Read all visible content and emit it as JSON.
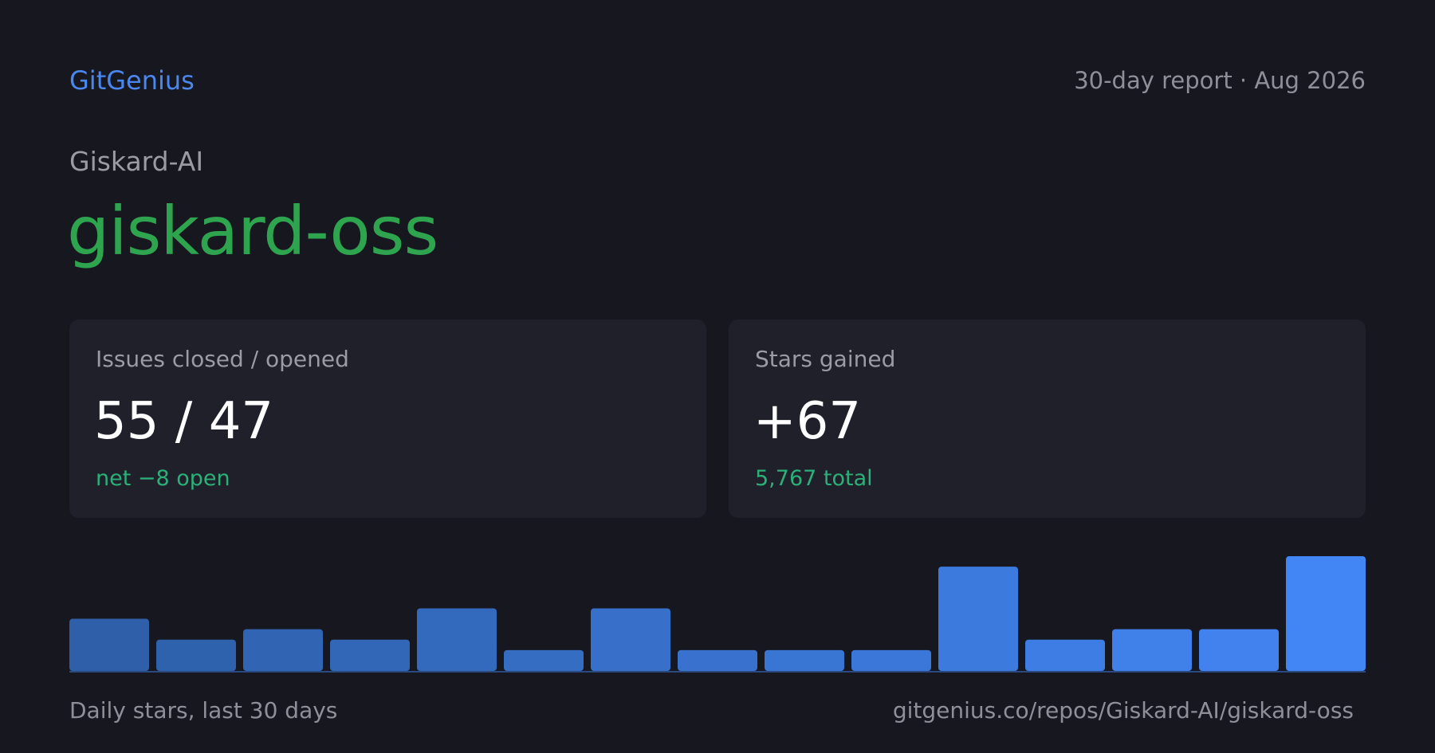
{
  "header": {
    "brand": "GitGenius",
    "report": "30-day report · Aug 2026"
  },
  "repo": {
    "org": "Giskard-AI",
    "name": "giskard-oss"
  },
  "cards": [
    {
      "label": "Issues closed / opened",
      "value": "55 / 47",
      "sub": "net −8 open"
    },
    {
      "label": "Stars gained",
      "value": "+67",
      "sub": "5,767 total"
    }
  ],
  "footer": {
    "caption": "Daily stars, last 30 days",
    "url": "gitgenius.co/repos/Giskard-AI/giskard-oss"
  },
  "colors": {
    "brand": "#4a88f0",
    "repo": "#2ea44f",
    "positive": "#2bb07a",
    "bar_gradient_start": "#2e5fa8",
    "bar_gradient_end": "#4285f4"
  },
  "chart_data": {
    "type": "bar",
    "categories": [
      "",
      "",
      "",
      "",
      "",
      "",
      "",
      "",
      "",
      "",
      "",
      "",
      "",
      "",
      ""
    ],
    "values": [
      5,
      3,
      4,
      3,
      6,
      2,
      6,
      2,
      2,
      2,
      10,
      3,
      4,
      4,
      11
    ],
    "title": "",
    "xlabel": "",
    "ylabel": "",
    "ylim": [
      0,
      11
    ],
    "grid": false,
    "legend": "none"
  }
}
